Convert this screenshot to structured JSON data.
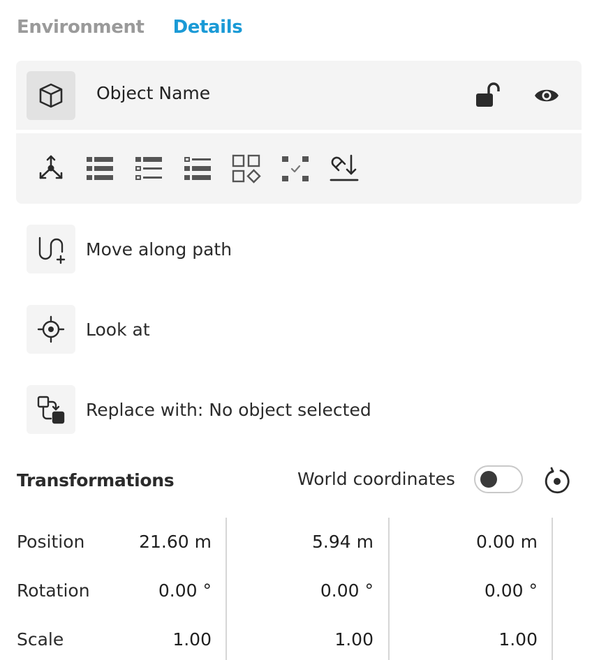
{
  "tabs": [
    {
      "label": "Environment",
      "active": false
    },
    {
      "label": "Details",
      "active": true
    }
  ],
  "colors": {
    "accent": "#1a9ad6",
    "inactive_tab": "#9a9a9a",
    "card_bg": "#f4f4f4"
  },
  "object": {
    "name": "Object Name",
    "icons": [
      "cube-icon",
      "unlock-icon",
      "eye-icon"
    ]
  },
  "toolbar": {
    "icons": [
      "axis-gizmo-icon",
      "list-all-icon",
      "list-partial-icon",
      "list-empty-icon",
      "grid-shapes-icon",
      "select-dots-icon",
      "magnet-drop-icon"
    ]
  },
  "actions": [
    {
      "label": "Move along path",
      "icon": "path-plus-icon"
    },
    {
      "label": "Look at",
      "icon": "target-icon"
    },
    {
      "label": "Replace with: No object selected",
      "icon": "replace-icon"
    }
  ],
  "transformations": {
    "title": "Transformations",
    "world_coordinates_label": "World coordinates",
    "world_coordinates_on": false,
    "rows": [
      {
        "label": "Position",
        "values": [
          "21.60 m",
          "5.94 m",
          "0.00 m"
        ]
      },
      {
        "label": "Rotation",
        "values": [
          "0.00 °",
          "0.00 °",
          "0.00 °"
        ]
      },
      {
        "label": "Scale",
        "values": [
          "1.00",
          "1.00",
          "1.00"
        ]
      }
    ]
  }
}
